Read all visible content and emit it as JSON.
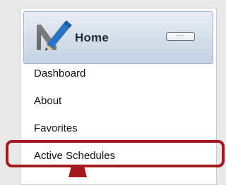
{
  "header": {
    "title": "Home",
    "logo_icon": "pencil-logo-icon",
    "toggle_icon": "collapse-dots-icon",
    "toggle_glyph": "···"
  },
  "nav": {
    "items": [
      {
        "label": "Dashboard"
      },
      {
        "label": "About"
      },
      {
        "label": "Favorites"
      },
      {
        "label": "Active Schedules"
      }
    ]
  },
  "colors": {
    "header_gradient_top": "#e9eef5",
    "header_gradient_bottom": "#c5d2e3",
    "highlight_border": "#a3191d",
    "logo_blue": "#2b73c4",
    "logo_gray": "#6e6e6e"
  }
}
